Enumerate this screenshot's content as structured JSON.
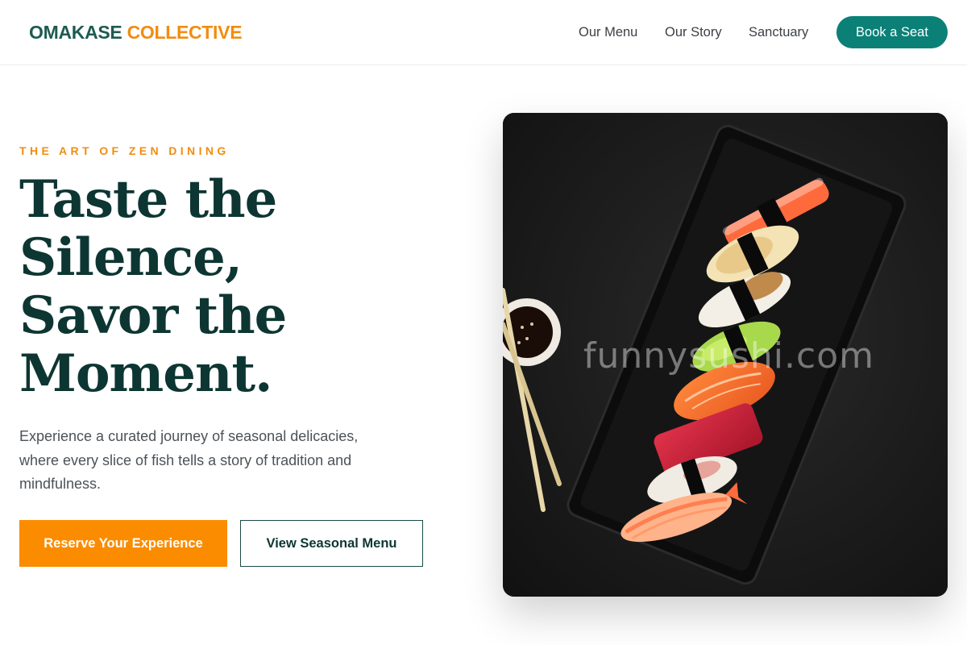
{
  "header": {
    "logo_part1": "OMAKASE",
    "logo_part2": "COLLECTIVE",
    "nav": [
      "Our Menu",
      "Our Story",
      "Sanctuary"
    ],
    "cta": "Book a Seat"
  },
  "hero": {
    "eyebrow": "THE ART OF ZEN DINING",
    "headline_lines": [
      "Taste the",
      "Silence,",
      "Savor the",
      "Moment."
    ],
    "description": "Experience a curated journey of seasonal delicacies, where every slice of fish tells a story of tradition and mindfulness.",
    "primary_button": "Reserve Your Experience",
    "secondary_button": "View Seasonal Menu",
    "image_watermark": "funnysushi.com"
  },
  "colors": {
    "brand_teal": "#1d5b52",
    "brand_orange": "#f28c0f",
    "cta_teal": "#0b8077",
    "headline": "#0d3633"
  }
}
